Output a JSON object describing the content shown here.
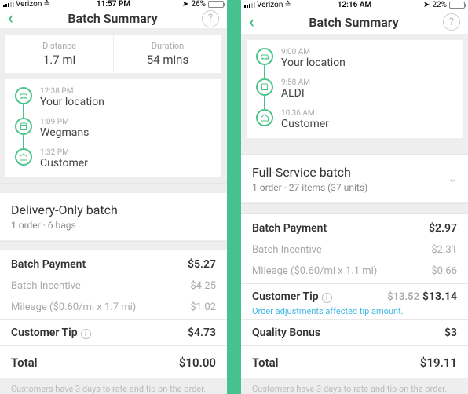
{
  "left": {
    "status": {
      "carrier": "Verizon",
      "time": "11:57 PM",
      "battery_pct": "26%",
      "battery_fill": 26
    },
    "nav": {
      "title": "Batch Summary"
    },
    "stats": {
      "distance_label": "Distance",
      "distance_value": "1.7 mi",
      "duration_label": "Duration",
      "duration_value": "54 mins"
    },
    "timeline": [
      {
        "time": "12:38 PM",
        "label": "Your location",
        "icon": "car"
      },
      {
        "time": "1:09 PM",
        "label": "Wegmans",
        "icon": "store"
      },
      {
        "time": "1:32 PM",
        "label": "Customer",
        "icon": "home"
      }
    ],
    "batch": {
      "title": "Delivery-Only batch",
      "sub": "1 order · 6 bags"
    },
    "payments": {
      "batch_payment_label": "Batch Payment",
      "batch_payment_value": "$5.27",
      "incentive_label": "Batch Incentive",
      "incentive_value": "$4.25",
      "mileage_label": "Mileage ($0.60/mi x 1.7 mi)",
      "mileage_value": "$1.02",
      "tip_label": "Customer Tip",
      "tip_value": "$4.73",
      "total_label": "Total",
      "total_value": "$10.00"
    },
    "footer": "Customers have 3 days to rate and tip on the order."
  },
  "right": {
    "status": {
      "carrier": "Verizon",
      "time": "12:16 AM",
      "battery_pct": "22%",
      "battery_fill": 22
    },
    "nav": {
      "title": "Batch Summary"
    },
    "timeline": [
      {
        "time": "9:00 AM",
        "label": "Your location",
        "icon": "car"
      },
      {
        "time": "9:58 AM",
        "label": "ALDI",
        "icon": "store"
      },
      {
        "time": "10:36 AM",
        "label": "Customer",
        "icon": "home"
      }
    ],
    "batch": {
      "title": "Full-Service batch",
      "sub": "1 order · 27 items (37 units)"
    },
    "payments": {
      "batch_payment_label": "Batch Payment",
      "batch_payment_value": "$2.97",
      "incentive_label": "Batch Incentive",
      "incentive_value": "$2.31",
      "mileage_label": "Mileage ($0.60/mi x 1.1 mi)",
      "mileage_value": "$0.66",
      "tip_label": "Customer Tip",
      "tip_strike": "$13.52",
      "tip_value": "$13.14",
      "tip_note": "Order adjustments affected tip amount.",
      "bonus_label": "Quality Bonus",
      "bonus_value": "$3",
      "total_label": "Total",
      "total_value": "$19.11"
    },
    "footer": "Customers have 3 days to rate and tip on the order."
  }
}
